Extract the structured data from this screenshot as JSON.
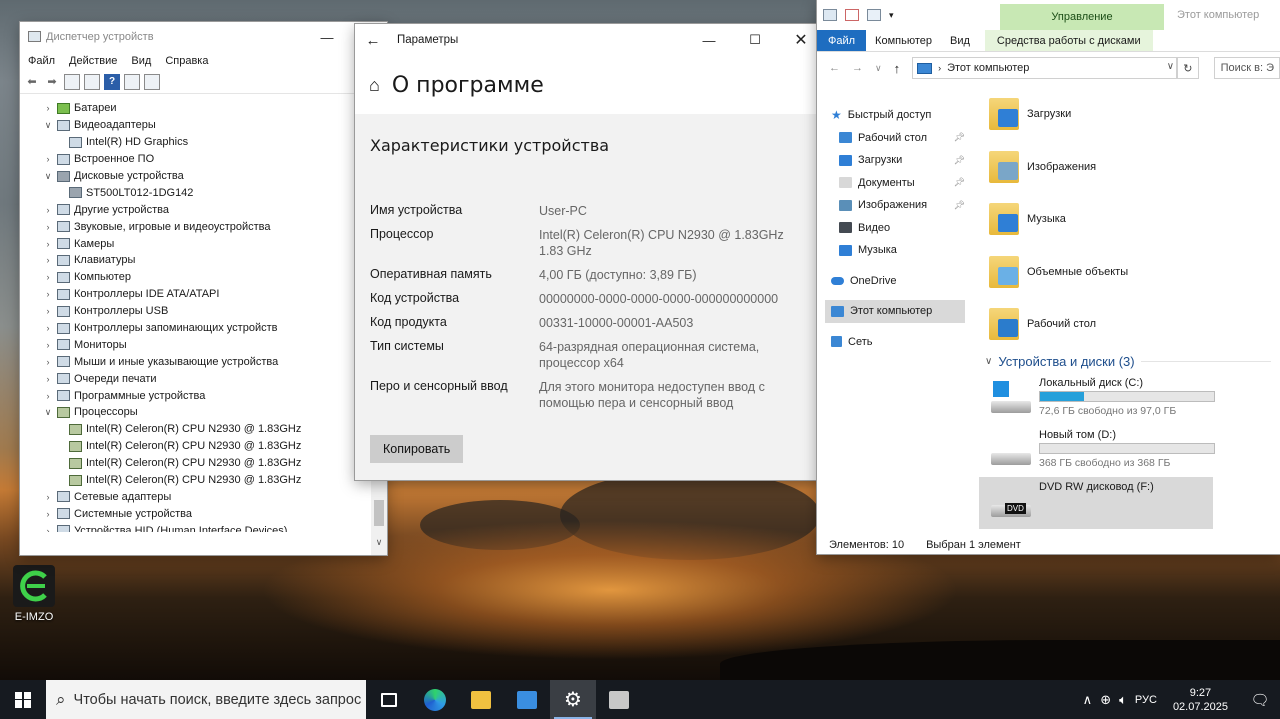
{
  "desktop": {
    "eimzo_label": "E-IMZO"
  },
  "device_manager": {
    "title": "Диспетчер устройств",
    "menu": [
      "Файл",
      "Действие",
      "Вид",
      "Справка"
    ],
    "tree": [
      {
        "label": "Батареи",
        "level": 1,
        "state": "collapsed",
        "icon": "battery-icon"
      },
      {
        "label": "Видеоадаптеры",
        "level": 1,
        "state": "expanded",
        "icon": "display-adapter-icon"
      },
      {
        "label": "Intel(R) HD Graphics",
        "level": 2,
        "state": "none",
        "icon": "display-adapter-icon"
      },
      {
        "label": "Встроенное ПО",
        "level": 1,
        "state": "collapsed",
        "icon": "firmware-icon"
      },
      {
        "label": "Дисковые устройства",
        "level": 1,
        "state": "expanded",
        "icon": "disk-icon"
      },
      {
        "label": "ST500LT012-1DG142",
        "level": 2,
        "state": "none",
        "icon": "disk-icon"
      },
      {
        "label": "Другие устройства",
        "level": 1,
        "state": "collapsed",
        "icon": "other-device-icon"
      },
      {
        "label": "Звуковые, игровые и видеоустройства",
        "level": 1,
        "state": "collapsed",
        "icon": "sound-icon"
      },
      {
        "label": "Камеры",
        "level": 1,
        "state": "collapsed",
        "icon": "camera-icon"
      },
      {
        "label": "Клавиатуры",
        "level": 1,
        "state": "collapsed",
        "icon": "keyboard-icon"
      },
      {
        "label": "Компьютер",
        "level": 1,
        "state": "collapsed",
        "icon": "computer-icon"
      },
      {
        "label": "Контроллеры IDE ATA/ATAPI",
        "level": 1,
        "state": "collapsed",
        "icon": "ide-controller-icon"
      },
      {
        "label": "Контроллеры USB",
        "level": 1,
        "state": "collapsed",
        "icon": "usb-icon"
      },
      {
        "label": "Контроллеры запоминающих устройств",
        "level": 1,
        "state": "collapsed",
        "icon": "storage-controller-icon"
      },
      {
        "label": "Мониторы",
        "level": 1,
        "state": "collapsed",
        "icon": "monitor-icon"
      },
      {
        "label": "Мыши и иные указывающие устройства",
        "level": 1,
        "state": "collapsed",
        "icon": "mouse-icon"
      },
      {
        "label": "Очереди печати",
        "level": 1,
        "state": "collapsed",
        "icon": "printer-icon"
      },
      {
        "label": "Программные устройства",
        "level": 1,
        "state": "collapsed",
        "icon": "software-device-icon"
      },
      {
        "label": "Процессоры",
        "level": 1,
        "state": "expanded",
        "icon": "cpu-icon"
      },
      {
        "label": "Intel(R) Celeron(R) CPU  N2930  @ 1.83GHz",
        "level": 2,
        "state": "none",
        "icon": "cpu-icon"
      },
      {
        "label": "Intel(R) Celeron(R) CPU  N2930  @ 1.83GHz",
        "level": 2,
        "state": "none",
        "icon": "cpu-icon"
      },
      {
        "label": "Intel(R) Celeron(R) CPU  N2930  @ 1.83GHz",
        "level": 2,
        "state": "none",
        "icon": "cpu-icon"
      },
      {
        "label": "Intel(R) Celeron(R) CPU  N2930  @ 1.83GHz",
        "level": 2,
        "state": "none",
        "icon": "cpu-icon"
      },
      {
        "label": "Сетевые адаптеры",
        "level": 1,
        "state": "collapsed",
        "icon": "network-adapter-icon"
      },
      {
        "label": "Системные устройства",
        "level": 1,
        "state": "collapsed",
        "icon": "system-device-icon"
      },
      {
        "label": "Устройства HID (Human Interface Devices)",
        "level": 1,
        "state": "collapsed",
        "icon": "hid-icon"
      }
    ]
  },
  "settings": {
    "window_title": "Параметры",
    "page_title": "О программе",
    "section_title": "Характеристики устройства",
    "specs": [
      {
        "key": "Имя устройства",
        "value": "User-PC"
      },
      {
        "key": "Процессор",
        "value": "Intel(R) Celeron(R) CPU  N2930  @ 1.83GHz 1.83 GHz"
      },
      {
        "key": "Оперативная память",
        "value": "4,00 ГБ (доступно: 3,89 ГБ)"
      },
      {
        "key": "Код устройства",
        "value": "00000000-0000-0000-0000-000000000000"
      },
      {
        "key": "Код продукта",
        "value": "00331-10000-00001-AA503"
      },
      {
        "key": "Тип системы",
        "value": "64-разрядная операционная система, процессор x64"
      },
      {
        "key": "Перо и сенсорный ввод",
        "value": "Для этого монитора недоступен ввод с помощью пера и сенсорный ввод"
      }
    ],
    "copy_label": "Копировать"
  },
  "explorer": {
    "context_tab": "Управление",
    "window_title": "Этот компьютер",
    "ribbon_tabs": [
      "Файл",
      "Компьютер",
      "Вид",
      "Средства работы с дисками"
    ],
    "address": "Этот компьютер",
    "search_placeholder": "Поиск в: Э",
    "nav": {
      "quick_access": "Быстрый доступ",
      "quick_items": [
        {
          "label": "Рабочий стол",
          "icon": "desktop-folder-icon",
          "color": "#3b87d4",
          "pinned": true
        },
        {
          "label": "Загрузки",
          "icon": "downloads-icon",
          "color": "#2f7fd6",
          "pinned": true
        },
        {
          "label": "Документы",
          "icon": "documents-icon",
          "color": "#d8d8d8",
          "pinned": true
        },
        {
          "label": "Изображения",
          "icon": "pictures-icon",
          "color": "#5a8fb8",
          "pinned": true
        },
        {
          "label": "Видео",
          "icon": "videos-icon",
          "color": "#444a52",
          "pinned": false
        },
        {
          "label": "Музыка",
          "icon": "music-icon",
          "color": "#2f7fd6",
          "pinned": false
        }
      ],
      "onedrive": "OneDrive",
      "this_pc": "Этот компьютер",
      "network": "Сеть"
    },
    "folders": [
      {
        "label": "Загрузки",
        "icon": "downloads-folder-icon",
        "mark_color": "#2f7fd6"
      },
      {
        "label": "Изображения",
        "icon": "pictures-folder-icon",
        "mark_color": "#7aa6c8"
      },
      {
        "label": "Музыка",
        "icon": "music-folder-icon",
        "mark_color": "#2f7fd6"
      },
      {
        "label": "Объемные объекты",
        "icon": "3d-objects-folder-icon",
        "mark_color": "#6ab0e6"
      },
      {
        "label": "Рабочий стол",
        "icon": "desktop-folder-icon",
        "mark_color": "#2b7ccc"
      }
    ],
    "devices_header": "Устройства и диски (3)",
    "drives": [
      {
        "name": "Локальный диск (C:)",
        "free": "72,6 ГБ свободно из 97,0 ГБ",
        "used_fraction": 0.25,
        "type": "system",
        "icon": "system-drive-icon"
      },
      {
        "name": "Новый том (D:)",
        "free": "368 ГБ свободно из 368 ГБ",
        "used_fraction": 0.0,
        "type": "hdd",
        "icon": "hard-drive-icon"
      },
      {
        "name": "DVD RW дисковод (F:)",
        "free": "",
        "type": "dvd",
        "icon": "dvd-drive-icon",
        "dvd_label": "DVD"
      }
    ],
    "status": {
      "items": "Элементов: 10",
      "selected": "Выбран 1 элемент"
    }
  },
  "taskbar": {
    "search_placeholder": "Чтобы начать поиск, введите здесь запрос",
    "apps": [
      {
        "name": "task-view-button",
        "icon": "task-view-icon",
        "color": "#ffffff",
        "active": false
      },
      {
        "name": "edge-button",
        "icon": "edge-icon",
        "color": "#2f9be6",
        "active": false
      },
      {
        "name": "file-explorer-button",
        "icon": "folder-icon",
        "color": "#f0c040",
        "active": false
      },
      {
        "name": "store-button",
        "icon": "store-icon",
        "color": "#3a8ee0",
        "active": false
      },
      {
        "name": "settings-button",
        "icon": "gear-icon",
        "color": "#ffffff",
        "active": true
      },
      {
        "name": "device-manager-button",
        "icon": "device-manager-icon",
        "color": "#c8c8c8",
        "active": false
      }
    ],
    "lang": "РУС",
    "time": "9:27",
    "date": "02.07.2025"
  }
}
